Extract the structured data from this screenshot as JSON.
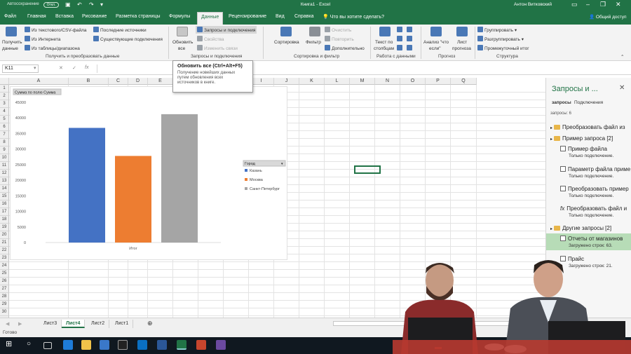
{
  "titlebar": {
    "autosave": "Автосохранение",
    "autosave_state": "Откл.",
    "title": "Книга1  -  Excel",
    "user": "Антон Витковский"
  },
  "tabs": [
    "Файл",
    "Главная",
    "Вставка",
    "Рисование",
    "Разметка страницы",
    "Формулы",
    "Данные",
    "Рецензирование",
    "Вид",
    "Справка"
  ],
  "tell_me": "Что вы хотите сделать?",
  "share": "Общий доступ",
  "ribbon": {
    "get_data": "Получить",
    "get_data2": "данные",
    "from_text": "Из текстового/CSV-файла",
    "from_web": "Из Интернета",
    "from_table": "Из таблицы/диапазона",
    "recent": "Последние источники",
    "existing": "Существующие подключения",
    "group1": "Получить и преобразовать данные",
    "refresh": "Обновить",
    "refresh2": "все",
    "queries_conn": "Запросы и подключения",
    "properties": "Свойства",
    "edit_links": "Изменить связи",
    "group2": "Запросы и подключения",
    "sort": "Сортировка",
    "filter": "Фильтр",
    "clear": "Очистить",
    "reapply": "Повторить",
    "advanced": "Дополнительно",
    "group3": "Сортировка и фильтр",
    "text_to_cols": "Текст по",
    "text_to_cols2": "столбцам",
    "group4": "Работа с данными",
    "whatif": "Анализ \"что",
    "whatif2": "если\"",
    "forecast": "Лист",
    "forecast2": "прогноза",
    "group5": "Прогноз",
    "group_btn": "Группировать",
    "ungroup_btn": "Разгруппировать",
    "subtotal": "Промежуточный итог",
    "group6": "Структура"
  },
  "tooltip": {
    "title": "Обновить все (Ctrl+Alt+F5)",
    "desc": "Получение новейших данных путем обновления всех источников в книге."
  },
  "formula_bar": {
    "name_box": "K11",
    "fx": "fx"
  },
  "columns": [
    "A",
    "B",
    "C",
    "D",
    "E",
    "F",
    "G",
    "H",
    "I",
    "J",
    "K",
    "L",
    "M",
    "N",
    "O",
    "P",
    "Q"
  ],
  "rows": [
    "1",
    "2",
    "3",
    "4",
    "5",
    "6",
    "7",
    "8",
    "9",
    "10",
    "11",
    "12",
    "13",
    "14",
    "15",
    "16",
    "17",
    "18",
    "19",
    "20",
    "21",
    "22",
    "23",
    "24",
    "25",
    "26",
    "27",
    "28",
    "29",
    "30",
    "31"
  ],
  "chart_data": {
    "type": "bar",
    "title": "",
    "field_button": "Сумма по полю Сумма",
    "categories": [
      "Итог"
    ],
    "series": [
      {
        "name": "Казань",
        "values": [
          36800
        ],
        "color": "#4472c4"
      },
      {
        "name": "Москва",
        "values": [
          27800
        ],
        "color": "#ed7d31"
      },
      {
        "name": "Санкт-Петербург",
        "values": [
          41200
        ],
        "color": "#a5a5a5"
      }
    ],
    "yticks": [
      "0",
      "5000",
      "10000",
      "15000",
      "20000",
      "25000",
      "30000",
      "35000",
      "40000",
      "45000"
    ],
    "ylim": [
      0,
      45000
    ],
    "legend_title": "Город",
    "legend_position": "right"
  },
  "pane": {
    "title": "Запросы и ...",
    "tab1": "запросы",
    "tab2": "Подключения",
    "count": "запросы: 6",
    "items": [
      {
        "label": "Преобразовать файл из",
        "type": "folder",
        "sub": ""
      },
      {
        "label": "Пример запроса [2]",
        "type": "folder",
        "sub": ""
      },
      {
        "label": "Пример файла",
        "type": "query",
        "sub": "Только подключение."
      },
      {
        "label": "Параметр файла приме",
        "type": "query",
        "sub": "Только подключение."
      },
      {
        "label": "Преобразовать пример",
        "type": "query",
        "sub": "Только подключение."
      },
      {
        "label": "Преобразовать файл и",
        "type": "fx",
        "sub": "Только подключение."
      },
      {
        "label": "Другие запросы [2]",
        "type": "folder",
        "sub": ""
      },
      {
        "label": "Отчеты от магазинов",
        "type": "query",
        "sub": "Загружено строк: 63."
      },
      {
        "label": "Прайс",
        "type": "query",
        "sub": "Загружено строк: 21."
      }
    ]
  },
  "sheets": [
    "Лист3",
    "Лист4",
    "Лист2",
    "Лист1"
  ],
  "status": "Готово"
}
